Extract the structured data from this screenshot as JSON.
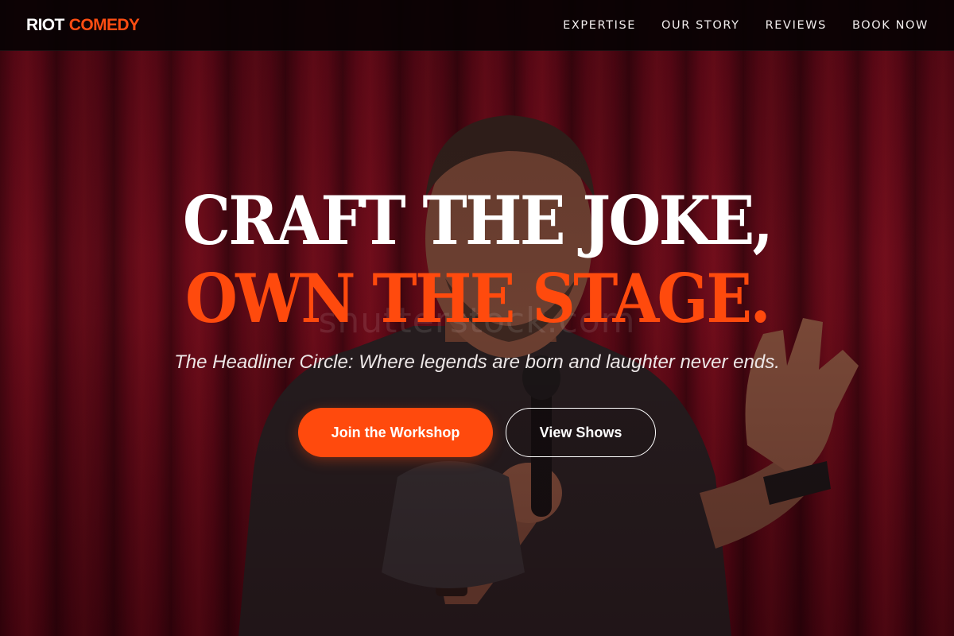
{
  "brand": {
    "name_part1": "RIOT",
    "name_part2": "COMEDY",
    "accent_color": "#ff4a0d"
  },
  "nav": {
    "items": [
      {
        "label": "EXPERTISE"
      },
      {
        "label": "OUR STORY"
      },
      {
        "label": "REVIEWS"
      },
      {
        "label": "BOOK NOW"
      }
    ]
  },
  "hero": {
    "headline_line1": "CRAFT THE JOKE,",
    "headline_line2": "OWN THE STAGE.",
    "tagline": "The Headliner Circle: Where legends are born and laughter never ends.",
    "primary_button": "Join the Workshop",
    "secondary_button": "View Shows",
    "watermark": "shutterstock.com",
    "background_image": "comedian-on-stage-red-curtain"
  }
}
